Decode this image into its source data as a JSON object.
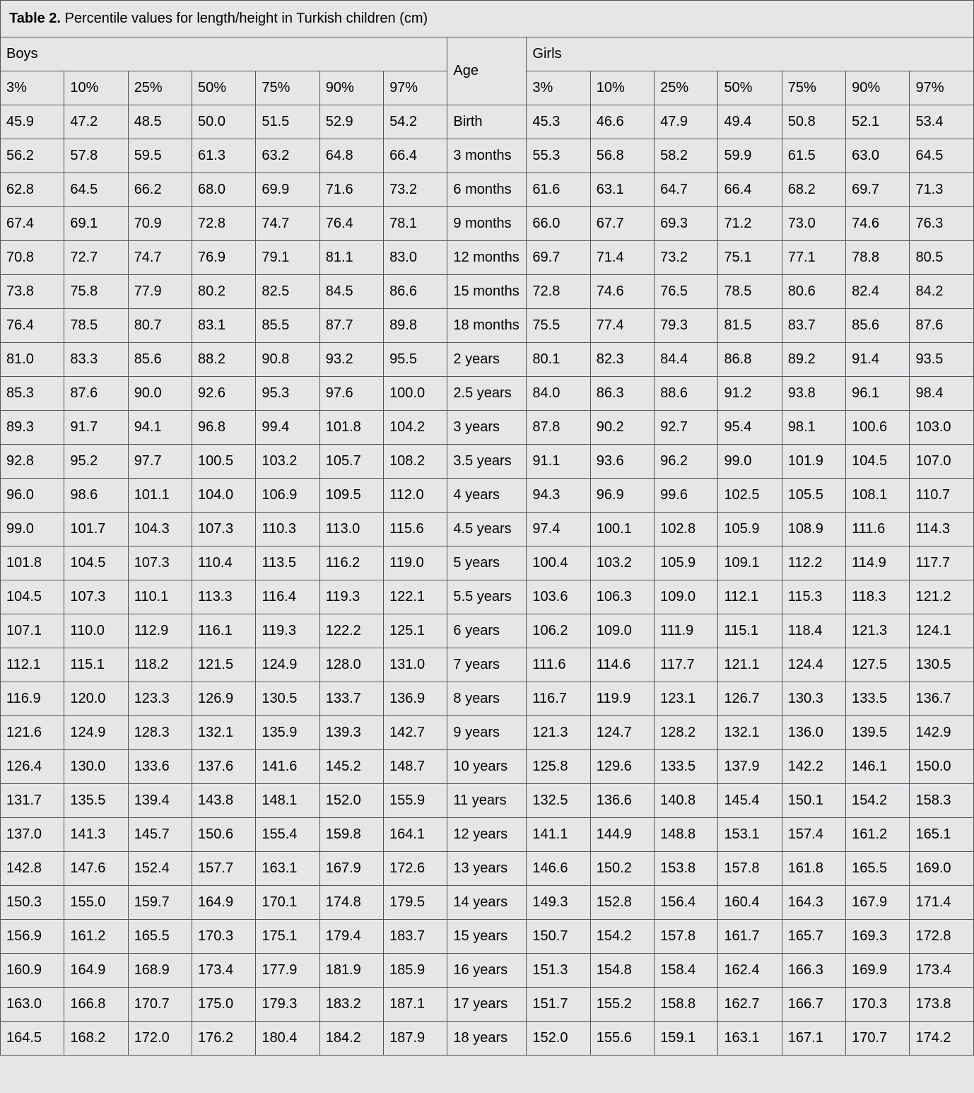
{
  "caption": {
    "label": "Table 2.",
    "text": "Percentile values for length/height in Turkish children (cm)"
  },
  "headers": {
    "boys": "Boys",
    "age": "Age",
    "girls": "Girls",
    "percentiles": [
      "3%",
      "10%",
      "25%",
      "50%",
      "75%",
      "90%",
      "97%"
    ]
  },
  "rows": [
    {
      "age": "Birth",
      "boys": [
        "45.9",
        "47.2",
        "48.5",
        "50.0",
        "51.5",
        "52.9",
        "54.2"
      ],
      "girls": [
        "45.3",
        "46.6",
        "47.9",
        "49.4",
        "50.8",
        "52.1",
        "53.4"
      ]
    },
    {
      "age": "3 months",
      "boys": [
        "56.2",
        "57.8",
        "59.5",
        "61.3",
        "63.2",
        "64.8",
        "66.4"
      ],
      "girls": [
        "55.3",
        "56.8",
        "58.2",
        "59.9",
        "61.5",
        "63.0",
        "64.5"
      ]
    },
    {
      "age": "6 months",
      "boys": [
        "62.8",
        "64.5",
        "66.2",
        "68.0",
        "69.9",
        "71.6",
        "73.2"
      ],
      "girls": [
        "61.6",
        "63.1",
        "64.7",
        "66.4",
        "68.2",
        "69.7",
        "71.3"
      ]
    },
    {
      "age": "9 months",
      "boys": [
        "67.4",
        "69.1",
        "70.9",
        "72.8",
        "74.7",
        "76.4",
        "78.1"
      ],
      "girls": [
        "66.0",
        "67.7",
        "69.3",
        "71.2",
        "73.0",
        "74.6",
        "76.3"
      ]
    },
    {
      "age": "12 months",
      "boys": [
        "70.8",
        "72.7",
        "74.7",
        "76.9",
        "79.1",
        "81.1",
        "83.0"
      ],
      "girls": [
        "69.7",
        "71.4",
        "73.2",
        "75.1",
        "77.1",
        "78.8",
        "80.5"
      ]
    },
    {
      "age": "15 months",
      "boys": [
        "73.8",
        "75.8",
        "77.9",
        "80.2",
        "82.5",
        "84.5",
        "86.6"
      ],
      "girls": [
        "72.8",
        "74.6",
        "76.5",
        "78.5",
        "80.6",
        "82.4",
        "84.2"
      ]
    },
    {
      "age": "18 months",
      "boys": [
        "76.4",
        "78.5",
        "80.7",
        "83.1",
        "85.5",
        "87.7",
        "89.8"
      ],
      "girls": [
        "75.5",
        "77.4",
        "79.3",
        "81.5",
        "83.7",
        "85.6",
        "87.6"
      ]
    },
    {
      "age": "2 years",
      "boys": [
        "81.0",
        "83.3",
        "85.6",
        "88.2",
        "90.8",
        "93.2",
        "95.5"
      ],
      "girls": [
        "80.1",
        "82.3",
        "84.4",
        "86.8",
        "89.2",
        "91.4",
        "93.5"
      ]
    },
    {
      "age": "2.5 years",
      "boys": [
        "85.3",
        "87.6",
        "90.0",
        "92.6",
        "95.3",
        "97.6",
        "100.0"
      ],
      "girls": [
        "84.0",
        "86.3",
        "88.6",
        "91.2",
        "93.8",
        "96.1",
        "98.4"
      ]
    },
    {
      "age": "3 years",
      "boys": [
        "89.3",
        "91.7",
        "94.1",
        "96.8",
        "99.4",
        "101.8",
        "104.2"
      ],
      "girls": [
        "87.8",
        "90.2",
        "92.7",
        "95.4",
        "98.1",
        "100.6",
        "103.0"
      ]
    },
    {
      "age": "3.5 years",
      "boys": [
        "92.8",
        "95.2",
        "97.7",
        "100.5",
        "103.2",
        "105.7",
        "108.2"
      ],
      "girls": [
        "91.1",
        "93.6",
        "96.2",
        "99.0",
        "101.9",
        "104.5",
        "107.0"
      ]
    },
    {
      "age": "4 years",
      "boys": [
        "96.0",
        "98.6",
        "101.1",
        "104.0",
        "106.9",
        "109.5",
        "112.0"
      ],
      "girls": [
        "94.3",
        "96.9",
        "99.6",
        "102.5",
        "105.5",
        "108.1",
        "110.7"
      ]
    },
    {
      "age": "4.5 years",
      "boys": [
        "99.0",
        "101.7",
        "104.3",
        "107.3",
        "110.3",
        "113.0",
        "115.6"
      ],
      "girls": [
        "97.4",
        "100.1",
        "102.8",
        "105.9",
        "108.9",
        "111.6",
        "114.3"
      ]
    },
    {
      "age": "5 years",
      "boys": [
        "101.8",
        "104.5",
        "107.3",
        "110.4",
        "113.5",
        "116.2",
        "119.0"
      ],
      "girls": [
        "100.4",
        "103.2",
        "105.9",
        "109.1",
        "112.2",
        "114.9",
        "117.7"
      ]
    },
    {
      "age": "5.5 years",
      "boys": [
        "104.5",
        "107.3",
        "110.1",
        "113.3",
        "116.4",
        "119.3",
        "122.1"
      ],
      "girls": [
        "103.6",
        "106.3",
        "109.0",
        "112.1",
        "115.3",
        "118.3",
        "121.2"
      ]
    },
    {
      "age": "6 years",
      "boys": [
        "107.1",
        "110.0",
        "112.9",
        "116.1",
        "119.3",
        "122.2",
        "125.1"
      ],
      "girls": [
        "106.2",
        "109.0",
        "111.9",
        "115.1",
        "118.4",
        "121.3",
        "124.1"
      ]
    },
    {
      "age": "7 years",
      "boys": [
        "112.1",
        "115.1",
        "118.2",
        "121.5",
        "124.9",
        "128.0",
        "131.0"
      ],
      "girls": [
        "111.6",
        "114.6",
        "117.7",
        "121.1",
        "124.4",
        "127.5",
        "130.5"
      ]
    },
    {
      "age": "8 years",
      "boys": [
        "116.9",
        "120.0",
        "123.3",
        "126.9",
        "130.5",
        "133.7",
        "136.9"
      ],
      "girls": [
        "116.7",
        "119.9",
        "123.1",
        "126.7",
        "130.3",
        "133.5",
        "136.7"
      ]
    },
    {
      "age": "9 years",
      "boys": [
        "121.6",
        "124.9",
        "128.3",
        "132.1",
        "135.9",
        "139.3",
        "142.7"
      ],
      "girls": [
        "121.3",
        "124.7",
        "128.2",
        "132.1",
        "136.0",
        "139.5",
        "142.9"
      ]
    },
    {
      "age": "10 years",
      "boys": [
        "126.4",
        "130.0",
        "133.6",
        "137.6",
        "141.6",
        "145.2",
        "148.7"
      ],
      "girls": [
        "125.8",
        "129.6",
        "133.5",
        "137.9",
        "142.2",
        "146.1",
        "150.0"
      ]
    },
    {
      "age": "11 years",
      "boys": [
        "131.7",
        "135.5",
        "139.4",
        "143.8",
        "148.1",
        "152.0",
        "155.9"
      ],
      "girls": [
        "132.5",
        "136.6",
        "140.8",
        "145.4",
        "150.1",
        "154.2",
        "158.3"
      ]
    },
    {
      "age": "12 years",
      "boys": [
        "137.0",
        "141.3",
        "145.7",
        "150.6",
        "155.4",
        "159.8",
        "164.1"
      ],
      "girls": [
        "141.1",
        "144.9",
        "148.8",
        "153.1",
        "157.4",
        "161.2",
        "165.1"
      ]
    },
    {
      "age": "13 years",
      "boys": [
        "142.8",
        "147.6",
        "152.4",
        "157.7",
        "163.1",
        "167.9",
        "172.6"
      ],
      "girls": [
        "146.6",
        "150.2",
        "153.8",
        "157.8",
        "161.8",
        "165.5",
        "169.0"
      ]
    },
    {
      "age": "14 years",
      "boys": [
        "150.3",
        "155.0",
        "159.7",
        "164.9",
        "170.1",
        "174.8",
        "179.5"
      ],
      "girls": [
        "149.3",
        "152.8",
        "156.4",
        "160.4",
        "164.3",
        "167.9",
        "171.4"
      ]
    },
    {
      "age": "15 years",
      "boys": [
        "156.9",
        "161.2",
        "165.5",
        "170.3",
        "175.1",
        "179.4",
        "183.7"
      ],
      "girls": [
        "150.7",
        "154.2",
        "157.8",
        "161.7",
        "165.7",
        "169.3",
        "172.8"
      ]
    },
    {
      "age": "16 years",
      "boys": [
        "160.9",
        "164.9",
        "168.9",
        "173.4",
        "177.9",
        "181.9",
        "185.9"
      ],
      "girls": [
        "151.3",
        "154.8",
        "158.4",
        "162.4",
        "166.3",
        "169.9",
        "173.4"
      ]
    },
    {
      "age": "17 years",
      "boys": [
        "163.0",
        "166.8",
        "170.7",
        "175.0",
        "179.3",
        "183.2",
        "187.1"
      ],
      "girls": [
        "151.7",
        "155.2",
        "158.8",
        "162.7",
        "166.7",
        "170.3",
        "173.8"
      ]
    },
    {
      "age": "18 years",
      "boys": [
        "164.5",
        "168.2",
        "172.0",
        "176.2",
        "180.4",
        "184.2",
        "187.9"
      ],
      "girls": [
        "152.0",
        "155.6",
        "159.1",
        "163.1",
        "167.1",
        "170.7",
        "174.2"
      ]
    }
  ]
}
